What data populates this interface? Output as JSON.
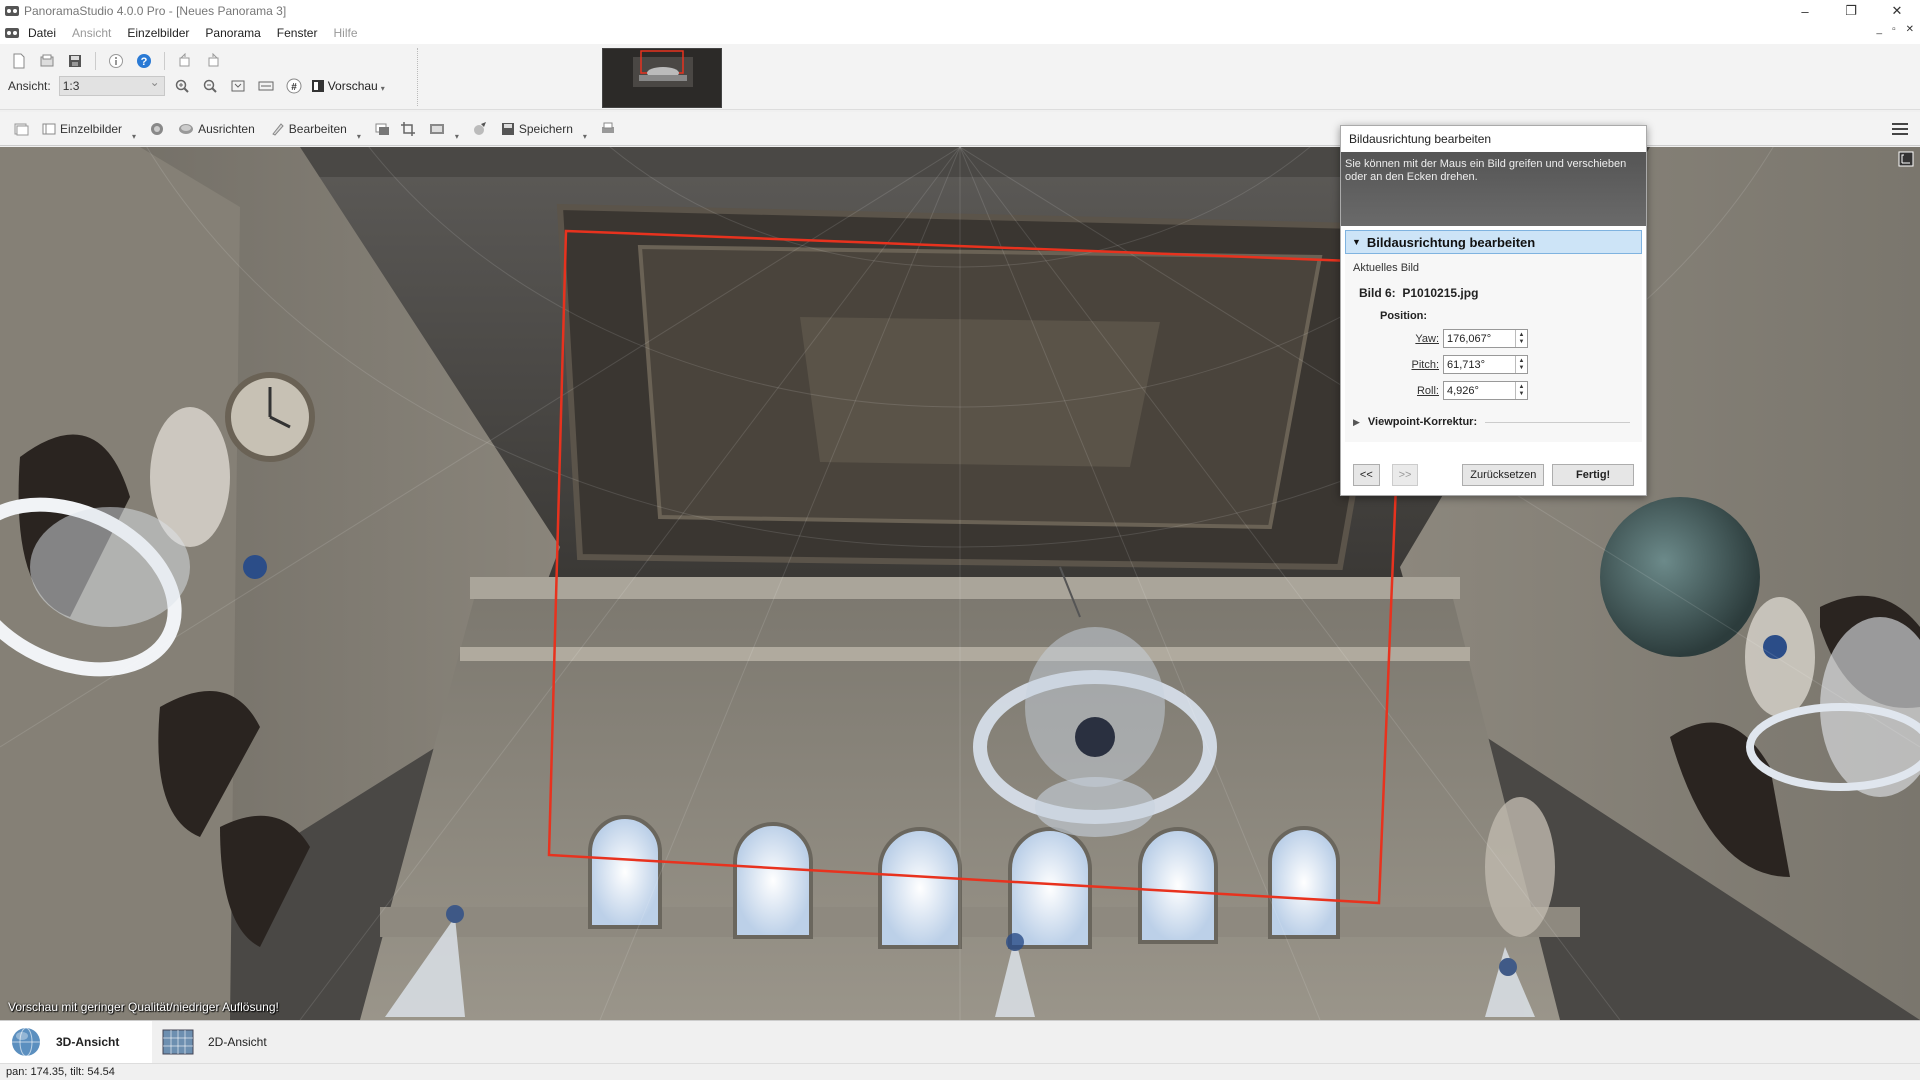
{
  "window": {
    "title": "PanoramaStudio 4.0.0 Pro - [Neues Panorama 3]",
    "controls": [
      "–",
      "❐",
      "✕"
    ]
  },
  "menu": {
    "items": [
      {
        "label": "Datei",
        "enabled": true
      },
      {
        "label": "Ansicht",
        "enabled": false
      },
      {
        "label": "Einzelbilder",
        "enabled": true
      },
      {
        "label": "Panorama",
        "enabled": true
      },
      {
        "label": "Fenster",
        "enabled": true
      },
      {
        "label": "Hilfe",
        "enabled": false
      }
    ],
    "mdi_controls": [
      "_",
      "▫",
      "✕"
    ]
  },
  "toolbar": {
    "ansicht_label": "Ansicht:",
    "ansicht_value": "1:3",
    "vorschau_label": "Vorschau"
  },
  "toolbar2": {
    "einzelbilder": "Einzelbilder",
    "ausrichten": "Ausrichten",
    "bearbeiten": "Bearbeiten",
    "speichern": "Speichern"
  },
  "viewport": {
    "preview_notice": "Vorschau mit geringer Qualität/niedriger Auflösung!"
  },
  "dialog": {
    "title": "Bildausrichtung bearbeiten",
    "info": "Sie können mit der Maus ein Bild greifen und verschieben oder an den Ecken drehen.",
    "section_title": "Bildausrichtung bearbeiten",
    "current_image_label": "Aktuelles Bild",
    "image_prefix": "Bild 6:",
    "image_name": "P1010215.jpg",
    "position_label": "Position:",
    "yaw_label": "Yaw:",
    "yaw_value": "176,067°",
    "pitch_label": "Pitch:",
    "pitch_value": "61,713°",
    "roll_label": "Roll:",
    "roll_value": "4,926°",
    "viewpoint_label": "Viewpoint-Korrektur:",
    "prev_label": "<<",
    "next_label": ">>",
    "reset_label": "Zurücksetzen",
    "done_label": "Fertig!"
  },
  "bottom_tabs": {
    "tab3d": "3D-Ansicht",
    "tab2d": "2D-Ansicht"
  },
  "status": {
    "text": "pan: 174.35, tilt: 54.54"
  },
  "colors": {
    "selection_outline": "#e8321e",
    "section_header_bg": "#cde4f7"
  }
}
